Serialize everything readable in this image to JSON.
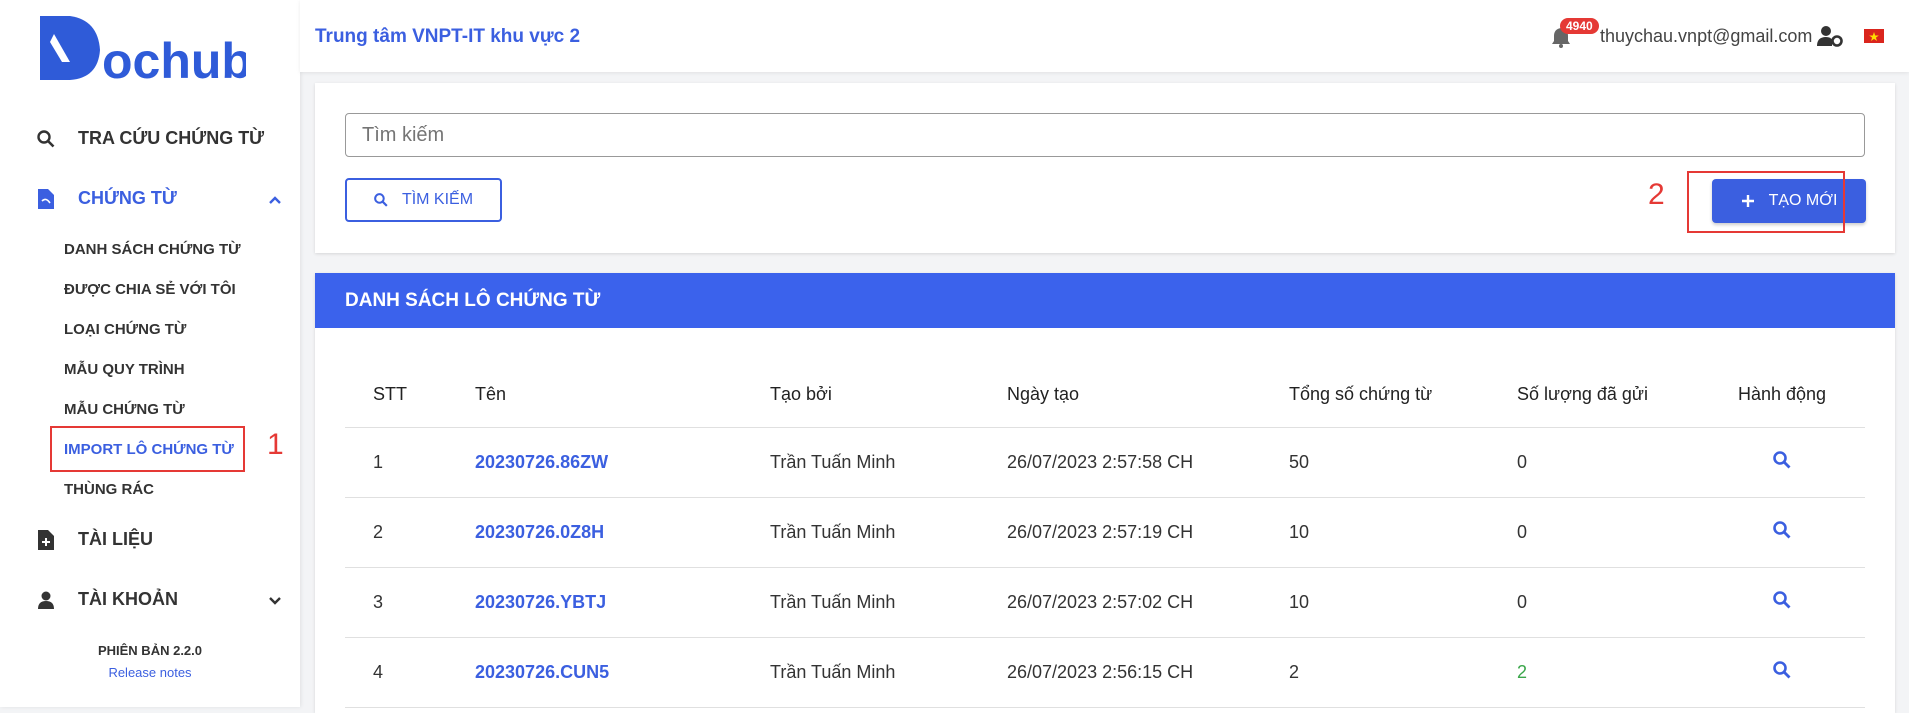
{
  "brand": {
    "logo_text": "ochub"
  },
  "sidebar": {
    "nav": [
      {
        "label": "TRA CỨU CHỨNG TỪ"
      },
      {
        "label": "CHỨNG TỪ"
      },
      {
        "label": "TÀI LIỆU"
      },
      {
        "label": "TÀI KHOẢN"
      }
    ],
    "sub_items": [
      {
        "label": "DANH SÁCH CHỨNG TỪ"
      },
      {
        "label": "ĐƯỢC CHIA SẺ VỚI TÔI"
      },
      {
        "label": "LOẠI CHỨNG TỪ"
      },
      {
        "label": "MẪU QUY TRÌNH"
      },
      {
        "label": "MẪU CHỨNG TỪ"
      },
      {
        "label": "IMPORT LÔ CHỨNG TỪ"
      },
      {
        "label": "THÙNG RÁC"
      }
    ],
    "version": "PHIÊN BẢN 2.2.0",
    "release_notes": "Release notes"
  },
  "annotations": {
    "one": "1",
    "two": "2"
  },
  "header": {
    "title": "Trung tâm VNPT-IT khu vực 2",
    "notification_count": "4940",
    "email": "thuychau.vnpt@gmail.com"
  },
  "search": {
    "placeholder": "Tìm kiếm",
    "button_label": "TÌM KIẾM",
    "create_label": "TẠO MỚI"
  },
  "list": {
    "title": "DANH SÁCH LÔ CHỨNG TỪ",
    "columns": [
      "STT",
      "Tên",
      "Tạo bởi",
      "Ngày tạo",
      "Tổng số chứng từ",
      "Số lượng đã gửi",
      "Hành động"
    ],
    "rows": [
      {
        "stt": "1",
        "name": "20230726.86ZW",
        "creator": "Trần Tuấn Minh",
        "date": "26/07/2023 2:57:58 CH",
        "total": "50",
        "sent": "0"
      },
      {
        "stt": "2",
        "name": "20230726.0Z8H",
        "creator": "Trần Tuấn Minh",
        "date": "26/07/2023 2:57:19 CH",
        "total": "10",
        "sent": "0"
      },
      {
        "stt": "3",
        "name": "20230726.YBTJ",
        "creator": "Trần Tuấn Minh",
        "date": "26/07/2023 2:57:02 CH",
        "total": "10",
        "sent": "0"
      },
      {
        "stt": "4",
        "name": "20230726.CUN5",
        "creator": "Trần Tuấn Minh",
        "date": "26/07/2023 2:56:15 CH",
        "total": "2",
        "sent": "2"
      }
    ]
  },
  "colors": {
    "accent": "#3b5fe0",
    "header_bar": "#3b62ec",
    "highlight": "#e53935",
    "success": "#3aa64a"
  }
}
